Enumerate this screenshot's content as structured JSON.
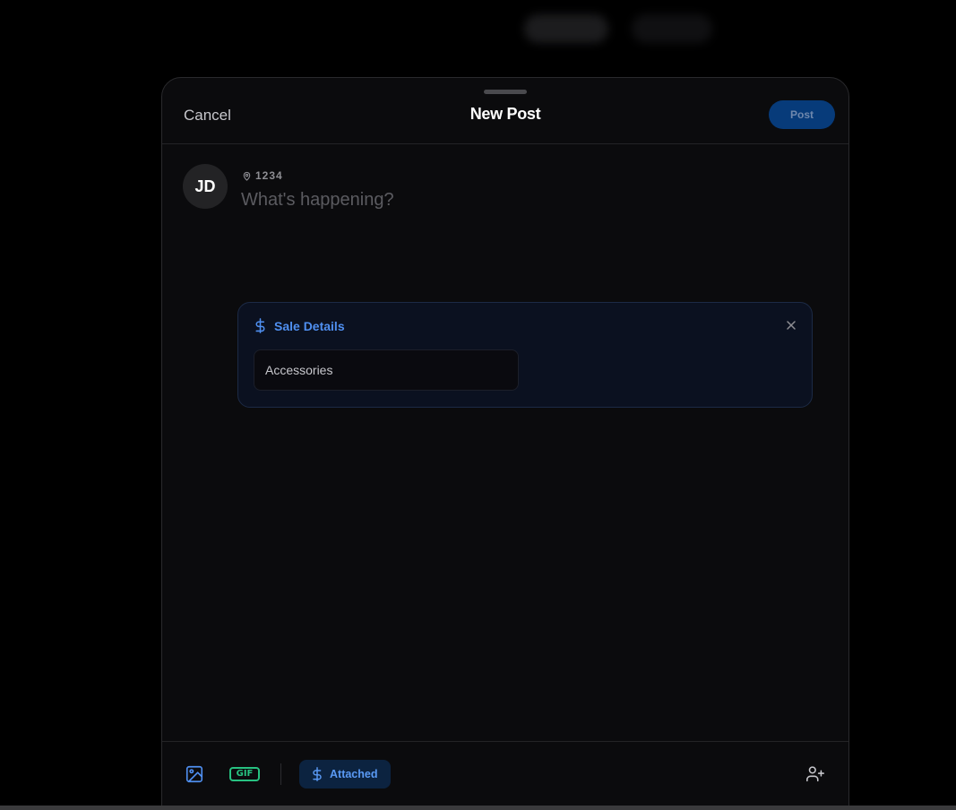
{
  "header": {
    "cancel_label": "Cancel",
    "title": "New Post",
    "post_label": "Post"
  },
  "composer": {
    "avatar_initials": "JD",
    "location_icon": "map-pin-icon",
    "location_text": "1234",
    "placeholder": "What's happening?",
    "value": ""
  },
  "sale_details": {
    "icon": "dollar-icon",
    "title": "Sale Details",
    "close_icon": "close-icon",
    "category_value": "Accessories"
  },
  "toolbar": {
    "image_icon": "image-icon",
    "gif_label": "GIF",
    "attached_icon": "dollar-icon",
    "attached_label": "Attached",
    "tag_icon": "user-plus-icon"
  },
  "colors": {
    "background": "#000000",
    "modal": "#0b0b0d",
    "accent_blue": "#4f8ff0",
    "post_button": "#073b7a",
    "gif_green": "#27c281"
  }
}
